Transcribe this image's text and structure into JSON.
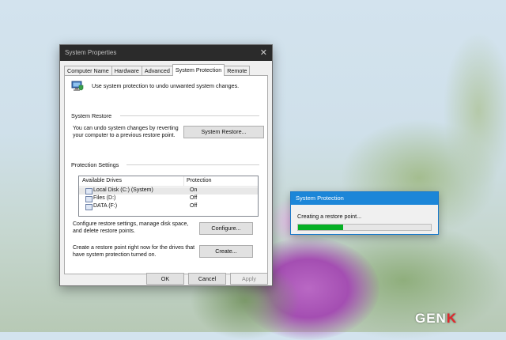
{
  "window": {
    "title": "System Properties",
    "close_glyph": "✕",
    "tabs": [
      {
        "label": "Computer Name",
        "active": false
      },
      {
        "label": "Hardware",
        "active": false
      },
      {
        "label": "Advanced",
        "active": false
      },
      {
        "label": "System Protection",
        "active": true
      },
      {
        "label": "Remote",
        "active": false
      }
    ],
    "intro": "Use system protection to undo unwanted system changes.",
    "system_restore": {
      "group_label": "System Restore",
      "description_line1": "You can undo system changes by reverting",
      "description_line2": "your computer to a previous restore point.",
      "button": "System Restore..."
    },
    "protection": {
      "group_label": "Protection Settings",
      "columns": [
        "Available Drives",
        "Protection"
      ],
      "drives": [
        {
          "name": "Local Disk (C:) (System)",
          "protection": "On",
          "selected": true
        },
        {
          "name": "Files (D:)",
          "protection": "Off",
          "selected": false
        },
        {
          "name": "DATA (F:)",
          "protection": "Off",
          "selected": false
        }
      ],
      "configure_line1": "Configure restore settings, manage disk space,",
      "configure_line2": "and delete restore points.",
      "configure_button": "Configure...",
      "create_line1": "Create a restore point right now for the drives that",
      "create_line2": "have system protection turned on.",
      "create_button": "Create..."
    },
    "footer": {
      "ok": "OK",
      "cancel": "Cancel",
      "apply": "Apply"
    }
  },
  "progress_dialog": {
    "title": "System Protection",
    "message": "Creating a restore point...",
    "progress": 0.34,
    "bar_color": "#06b025"
  },
  "watermark": {
    "part1": "GEN",
    "part2": "K"
  },
  "icons": {
    "intro": "computer-shield-icon",
    "drive": "drive-icon"
  }
}
